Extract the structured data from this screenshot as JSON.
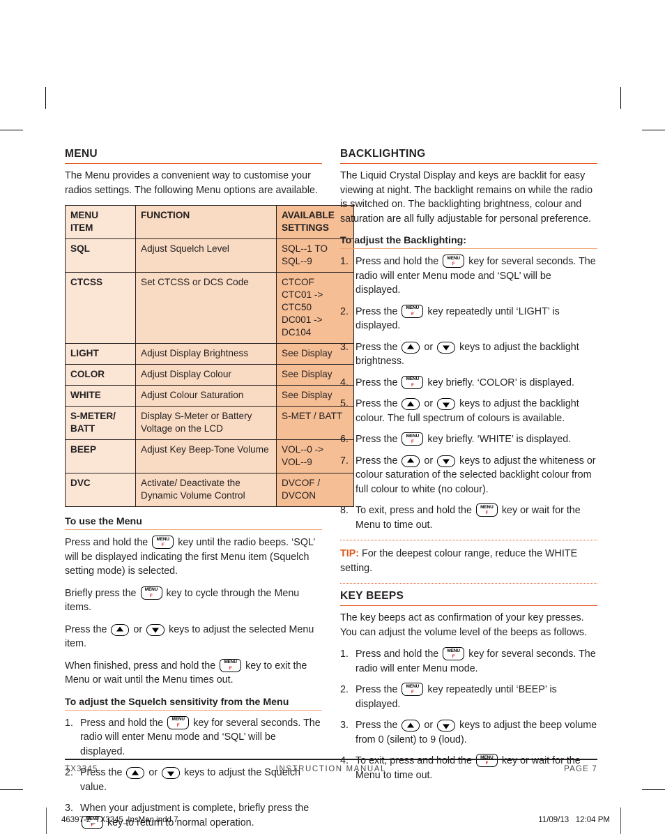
{
  "left": {
    "section1": {
      "heading": "MENU",
      "intro": "The Menu provides a convenient way to customise your radios settings. The following Menu options are available.",
      "table": {
        "headers": [
          "MENU ITEM",
          "FUNCTION",
          "AVAILABLE SETTINGS"
        ],
        "header_lines": {
          "col1": [
            "MENU",
            "ITEM"
          ],
          "col2": [
            "FUNCTION"
          ],
          "col3": [
            "AVAILABLE",
            "SETTINGS"
          ]
        },
        "rows": [
          {
            "item": [
              "SQL"
            ],
            "function": [
              "Adjust Squelch Level"
            ],
            "settings": [
              "SQL--1 TO SQL--9"
            ]
          },
          {
            "item": [
              "CTCSS"
            ],
            "function": [
              "Set CTCSS or DCS Code"
            ],
            "settings": [
              "CTCOF",
              "CTC01 -> CTC50",
              "DC001 -> DC104"
            ]
          },
          {
            "item": [
              "LIGHT"
            ],
            "function": [
              "Adjust Display Brightness"
            ],
            "settings": [
              "See Display"
            ]
          },
          {
            "item": [
              "COLOR"
            ],
            "function": [
              "Adjust Display Colour"
            ],
            "settings": [
              "See Display"
            ]
          },
          {
            "item": [
              "WHITE"
            ],
            "function": [
              "Adjust Colour Saturation"
            ],
            "settings": [
              "See Display"
            ]
          },
          {
            "item": [
              "S-METER/",
              "BATT"
            ],
            "function": [
              "Display S-Meter or Battery Voltage on the LCD"
            ],
            "settings": [
              "S-MET / BATT"
            ]
          },
          {
            "item": [
              "BEEP"
            ],
            "function": [
              "Adjust Key Beep-Tone Volume"
            ],
            "settings": [
              "VOL--0 ->",
              "VOL--9"
            ]
          },
          {
            "item": [
              "DVC"
            ],
            "function": [
              "Activate/ Deactivate the Dynamic Volume Control"
            ],
            "settings": [
              "DVCOF / DVCON"
            ]
          }
        ]
      }
    },
    "section2": {
      "heading": "To use the Menu",
      "p1_a": "Press and hold the",
      "p1_b": "key until the radio beeps. ‘SQL’ will be displayed indicating the first Menu item (Squelch setting mode) is selected.",
      "p2_a": "Briefly press the",
      "p2_b": "key to cycle through the Menu items.",
      "p3_a": "Press the",
      "p3_or": "or",
      "p3_b": "keys to adjust the selected Menu item.",
      "p4_a": "When finished, press and hold the",
      "p4_b": "key to exit the Menu or wait until the Menu times out."
    },
    "section3": {
      "heading": "To adjust the Squelch sensitivity from the Menu",
      "steps": [
        {
          "a": "Press and hold the",
          "key": "menu",
          "b": "key for several seconds. The radio will enter Menu mode and ‘SQL’ will be displayed."
        },
        {
          "a": "Press the",
          "key": "updown",
          "or": "or",
          "b": "keys to adjust the Squelch value."
        },
        {
          "a": "When your adjustment is complete, briefly press the",
          "key": "menu",
          "b": "key to return to normal operation."
        }
      ]
    }
  },
  "right": {
    "section1": {
      "heading": "BACKLIGHTING",
      "intro": "The Liquid Crystal Display and keys are backlit for easy viewing at night. The backlight remains on while the radio is switched on. The backlighting brightness, colour and saturation are all fully adjustable for personal preference."
    },
    "section2": {
      "heading": "To adjust the Backlighting:",
      "steps": [
        {
          "a": "Press and hold the",
          "key": "menu",
          "b": "key for several seconds. The radio will enter Menu mode and ‘SQL’ will be displayed."
        },
        {
          "a": "Press the",
          "key": "menu",
          "b": "key repeatedly until ‘LIGHT’ is displayed."
        },
        {
          "a": "Press the",
          "key": "updown",
          "or": "or",
          "b": "keys to adjust the backlight brightness."
        },
        {
          "a": "Press the",
          "key": "menu",
          "b": "key briefly. ‘COLOR’ is displayed."
        },
        {
          "a": "Press the",
          "key": "updown",
          "or": "or",
          "b": "keys to adjust the backlight colour. The full spectrum of colours is available."
        },
        {
          "a": "Press the",
          "key": "menu",
          "b": "key briefly. ‘WHITE’ is displayed."
        },
        {
          "a": "Press the",
          "key": "updown",
          "or": "or",
          "b": "keys to adjust the whiteness or colour saturation of the selected backlight colour from full colour to white (no colour)."
        },
        {
          "a": "To exit, press and hold the",
          "key": "menu",
          "b": "key or wait for the Menu to time out."
        }
      ]
    },
    "tip": {
      "label": "TIP:",
      "text": " For the deepest colour range, reduce the WHITE setting."
    },
    "section3": {
      "heading": "KEY BEEPS",
      "intro": "The key beeps act as confirmation of your key presses. You can adjust the volume level of the beeps as follows.",
      "steps": [
        {
          "a": "Press and hold the",
          "key": "menu",
          "b": "key for several seconds. The radio will enter Menu mode."
        },
        {
          "a": "Press the",
          "key": "menu",
          "b": "key repeatedly until ‘BEEP’ is displayed."
        },
        {
          "a": "Press the",
          "key": "updown",
          "or": "or",
          "b": "keys to adjust the beep volume from 0 (silent) to 9 (loud)."
        },
        {
          "a": "To exit, press and hold the",
          "key": "menu",
          "b": "key or wait for the Menu to time out."
        }
      ]
    }
  },
  "keys": {
    "menu_top": "MENU",
    "menu_bottom": "F"
  },
  "footer": {
    "left": "TX3345",
    "middle": "INSTRUCTION MANUAL",
    "right": "PAGE 7"
  },
  "slug": {
    "left": "46397-2_TX3345_InsMan.indd   7",
    "right": "11/09/13   12:04 PM"
  },
  "colors": {
    "accent_orange": "#E2571E",
    "subheading_rule": "#F1A476",
    "table_col1": "#FBE6D6",
    "table_col2": "#F9DAC2",
    "table_col3": "#F5BE95",
    "key_f_red": "#E01B22",
    "text": "#231f20"
  }
}
